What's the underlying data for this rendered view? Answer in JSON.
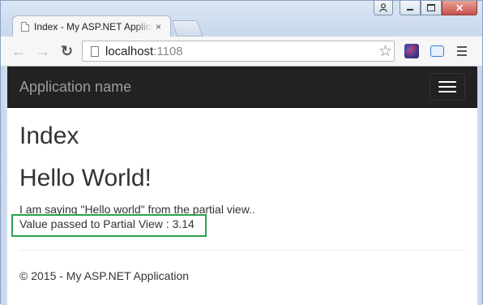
{
  "browser": {
    "tab_title": "Index - My ASP.NET Application",
    "tab_close": "×",
    "url_host": "localhost",
    "url_port": ":1108",
    "back_glyph": "←",
    "forward_glyph": "→",
    "reload_glyph": "↻",
    "star_glyph": "☆",
    "min_glyph": "",
    "close_glyph": "✕"
  },
  "navbar": {
    "brand": "Application name"
  },
  "page": {
    "heading": "Index",
    "subheading": "Hello World!",
    "partial_text": "I am saying \"Hello world\" from the partial view..",
    "value_text": "Value passed to Partial View : 3.14",
    "footer": "© 2015 - My ASP.NET Application"
  },
  "colors": {
    "navbar_bg": "#222222",
    "brand_text": "#9d9d9d",
    "highlight_border": "#2ca24b"
  },
  "icons": {
    "back": "back-arrow-icon",
    "forward": "forward-arrow-icon",
    "reload": "reload-icon",
    "page": "page-icon",
    "star": "bookmark-star-icon",
    "menu": "hamburger-menu-icon"
  }
}
